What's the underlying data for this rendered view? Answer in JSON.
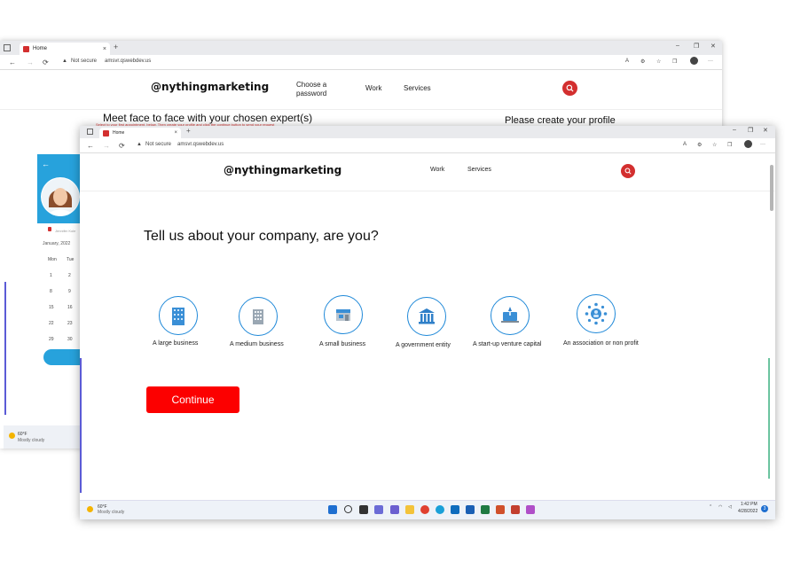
{
  "back_window": {
    "tab_title": "Home",
    "tab_close": "×",
    "new_tab": "+",
    "window_controls": [
      "–",
      "❐",
      "✕"
    ],
    "address": {
      "not_secure": "Not secure",
      "url": "amsvr.qswebdev.us"
    },
    "header": {
      "brand": "@nythingmarketing",
      "choose_password": "Choose a password",
      "nav_work": "Work",
      "nav_services": "Services"
    },
    "meet_title": "Meet face to face with your chosen expert(s)",
    "note": "Select to your first appointment, below. Then create your profile and click the continue button to send your request",
    "profile_title": "Please create your profile",
    "card": {
      "subtitle": "Jennifer Kole",
      "month": "January, 2022",
      "weekdays": [
        "Mon",
        "Tue"
      ],
      "days": [
        [
          "1",
          "2"
        ],
        [
          "8",
          "9"
        ],
        [
          "15",
          "16"
        ],
        [
          "22",
          "23"
        ],
        [
          "29",
          "30"
        ]
      ]
    },
    "taskbar": {
      "temp": "60°F",
      "condition": "Mostly cloudy"
    }
  },
  "front_window": {
    "tab_title": "Home",
    "tab_close": "×",
    "new_tab": "+",
    "window_controls": [
      "–",
      "❐",
      "✕"
    ],
    "address": {
      "not_secure": "Not secure",
      "url": "amsvr.qswebdev.us"
    },
    "header": {
      "brand": "@nythingmarketing",
      "nav_work": "Work",
      "nav_services": "Services"
    },
    "question": "Tell us about your company, are you?",
    "options": [
      {
        "label": "A large business",
        "icon": "office-tower-icon"
      },
      {
        "label": "A medium business",
        "icon": "office-building-icon"
      },
      {
        "label": "A small business",
        "icon": "storefront-icon"
      },
      {
        "label": "A government entity",
        "icon": "government-building-icon"
      },
      {
        "label": "A start-up venture capital",
        "icon": "startup-laptop-icon"
      },
      {
        "label": "An association or non profit",
        "icon": "network-people-icon"
      }
    ],
    "continue_label": "Continue",
    "taskbar": {
      "temp": "60°F",
      "condition": "Mostly cloudy",
      "time": "1:42 PM",
      "date": "4/28/2022",
      "notifications": "3"
    }
  },
  "colors": {
    "brand_red": "#d32f2f",
    "continue_red": "#fc0000",
    "option_blue": "#1e88d8",
    "card_blue": "#27a2dc"
  }
}
